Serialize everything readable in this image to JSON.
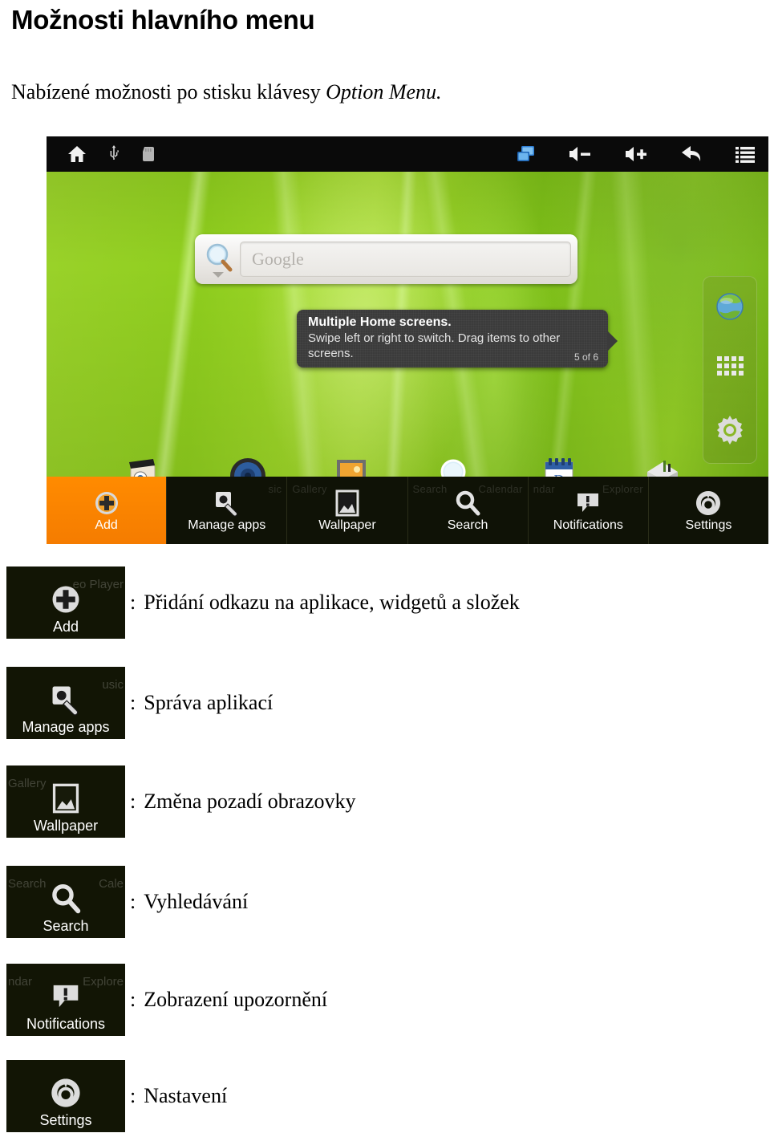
{
  "document": {
    "title": "Možnosti hlavního menu",
    "subtitle_prefix": "Nabízené možnosti po stisku klávesy ",
    "subtitle_italic": "Option Menu."
  },
  "screenshot": {
    "status_bar": {
      "left_icons": [
        "home-icon",
        "usb-icon",
        "sdcard-icon"
      ],
      "right_icons": [
        "screenshot-icon",
        "volume-down-icon",
        "volume-up-icon",
        "back-arrow-icon",
        "menu-icon"
      ]
    },
    "search_widget": {
      "icon": "magnifier-icon",
      "placeholder": "Google",
      "dropdown": "caret-down-icon"
    },
    "tooltip": {
      "title": "Multiple Home screens.",
      "body": "Swipe left or right to switch. Drag items to other screens.",
      "counter": "5 of 6"
    },
    "side_dock": {
      "items": [
        "browser-globe-icon",
        "app-drawer-grid-icon",
        "settings-gear-icon"
      ]
    },
    "app_row": {
      "items": [
        "video-player-icon",
        "music-icon",
        "gallery-icon",
        "search-icon",
        "calendar-icon",
        "explorer-icon"
      ]
    },
    "option_menu": {
      "items": [
        {
          "label": "Add",
          "icon": "plus-circle-icon",
          "active": true,
          "ghost_left": "",
          "ghost_right": ""
        },
        {
          "label": "Manage apps",
          "icon": "app-wrench-icon",
          "active": false,
          "ghost_left": "",
          "ghost_right": "sic"
        },
        {
          "label": "Wallpaper",
          "icon": "picture-icon",
          "active": false,
          "ghost_left": "Gallery",
          "ghost_right": ""
        },
        {
          "label": "Search",
          "icon": "magnifier-icon",
          "active": false,
          "ghost_left": "Search",
          "ghost_right": "Calendar"
        },
        {
          "label": "Notifications",
          "icon": "speech-alert-icon",
          "active": false,
          "ghost_left": "ndar",
          "ghost_right": "Explorer"
        },
        {
          "label": "Settings",
          "icon": "settings-gear-icon",
          "active": false,
          "ghost_left": "",
          "ghost_right": ""
        }
      ]
    }
  },
  "legend": {
    "separator": ":",
    "rows": [
      {
        "label": "Add",
        "icon": "plus-circle-icon",
        "ghost_left": "",
        "ghost_right": "eo Player",
        "description": "Přidání odkazu na aplikace, widgetů a složek"
      },
      {
        "label": "Manage apps",
        "icon": "app-wrench-icon",
        "ghost_left": "",
        "ghost_right": "usic",
        "description": "Správa aplikací"
      },
      {
        "label": "Wallpaper",
        "icon": "picture-icon",
        "ghost_left": "Gallery",
        "ghost_right": "",
        "description": "Změna pozadí obrazovky"
      },
      {
        "label": "Search",
        "icon": "magnifier-icon",
        "ghost_left": "Search",
        "ghost_right": "Cale",
        "description": "Vyhledávání"
      },
      {
        "label": "Notifications",
        "icon": "speech-alert-icon",
        "ghost_left": "ndar",
        "ghost_right": "Explore",
        "description": "Zobrazení upozornění"
      },
      {
        "label": "Settings",
        "icon": "settings-gear-icon",
        "ghost_left": "",
        "ghost_right": "",
        "description": "Nastavení"
      }
    ]
  },
  "colors": {
    "accent_orange": "#F57C00",
    "status_bar": "#0A0A0A",
    "wallpaper_green": "#8FCE1E",
    "menu_dark": "#0F1206"
  }
}
